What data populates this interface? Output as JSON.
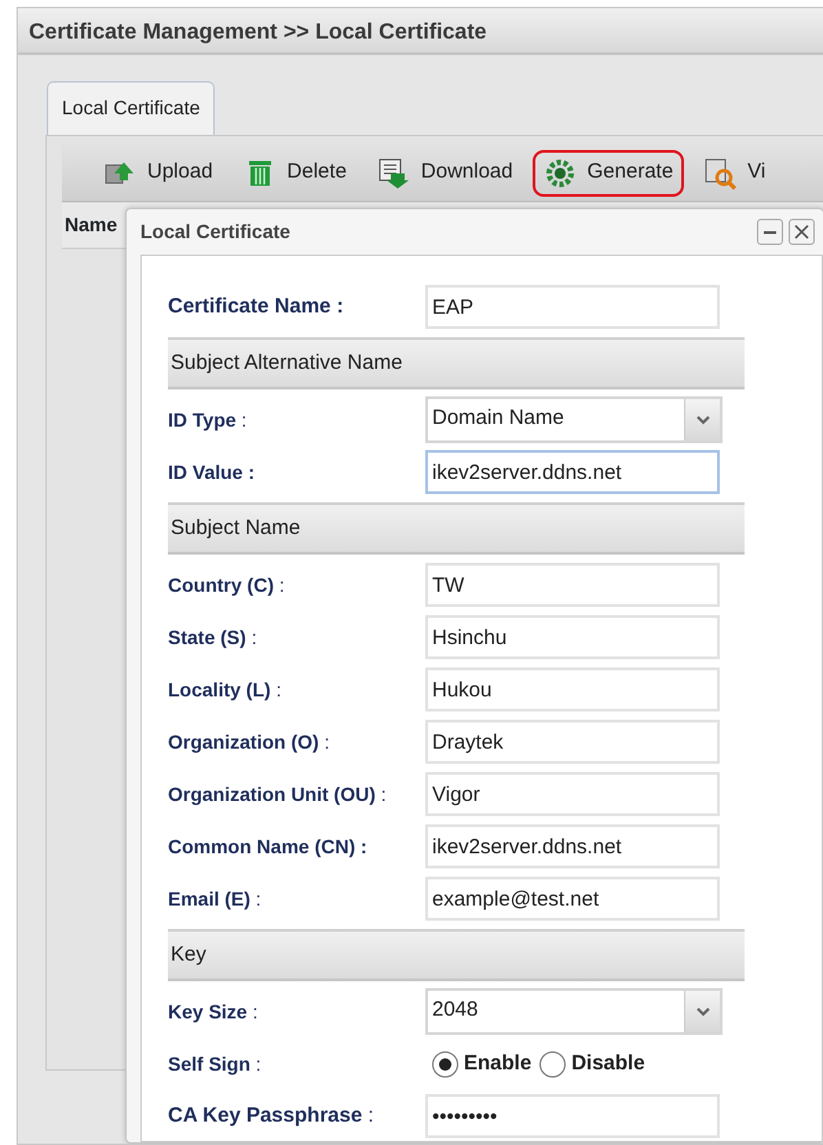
{
  "page_title": "Certificate Management >> Local Certificate",
  "tabs": [
    {
      "label": "Local Certificate",
      "selected": true
    }
  ],
  "toolbar": [
    {
      "label": "Upload",
      "kind": "upload",
      "highlighted": false
    },
    {
      "label": "Delete",
      "kind": "delete",
      "highlighted": false
    },
    {
      "label": "Download",
      "kind": "download",
      "highlighted": false
    },
    {
      "label": "Generate",
      "kind": "generate",
      "highlighted": true
    },
    {
      "label": "Vi",
      "kind": "view",
      "highlighted": false
    }
  ],
  "table": {
    "columns": [
      "Name"
    ]
  },
  "dialog": {
    "title": "Local Certificate",
    "rows": [
      {
        "kind": "text",
        "label": "Certificate Name",
        "colon": ":",
        "colon_bold": true,
        "large": true,
        "value": "EAP",
        "focused": false
      },
      {
        "kind": "section",
        "label": "Subject Alternative Name"
      },
      {
        "kind": "select",
        "label": "ID Type",
        "colon": ":",
        "colon_bold": false,
        "value": "Domain Name"
      },
      {
        "kind": "text",
        "label": "ID Value",
        "colon": ":",
        "colon_bold": true,
        "value": "ikev2server.ddns.net",
        "focused": true
      },
      {
        "kind": "section",
        "label": "Subject Name"
      },
      {
        "kind": "text",
        "label": "Country (C)",
        "colon": ":",
        "colon_bold": false,
        "value": "TW",
        "focused": false
      },
      {
        "kind": "text",
        "label": "State (S)",
        "colon": ":",
        "colon_bold": false,
        "value": "Hsinchu",
        "focused": false
      },
      {
        "kind": "text",
        "label": "Locality (L)",
        "colon": ":",
        "colon_bold": false,
        "value": "Hukou",
        "focused": false
      },
      {
        "kind": "text",
        "label": "Organization (O)",
        "colon": ":",
        "colon_bold": false,
        "value": "Draytek",
        "focused": false
      },
      {
        "kind": "text",
        "label": "Organization Unit (OU)",
        "colon": ":",
        "colon_bold": false,
        "value": "Vigor",
        "focused": false
      },
      {
        "kind": "text",
        "label": "Common Name (CN)",
        "colon": ":",
        "colon_bold": true,
        "value": "ikev2server.ddns.net",
        "focused": false
      },
      {
        "kind": "text",
        "label": "Email (E)",
        "colon": ":",
        "colon_bold": false,
        "value": "example@test.net",
        "focused": false
      },
      {
        "kind": "section",
        "label": "Key"
      },
      {
        "kind": "select",
        "label": "Key Size",
        "colon": ":",
        "colon_bold": false,
        "value": "2048"
      },
      {
        "kind": "radio",
        "label": "Self Sign",
        "colon": ":",
        "colon_bold": false,
        "options": [
          {
            "label": "Enable",
            "selected": true
          },
          {
            "label": "Disable",
            "selected": false
          }
        ]
      },
      {
        "kind": "text",
        "label": "CA Key Passphrase",
        "colon": ":",
        "colon_bold": false,
        "large": true,
        "value": "•••••••••",
        "focused": false
      }
    ]
  }
}
